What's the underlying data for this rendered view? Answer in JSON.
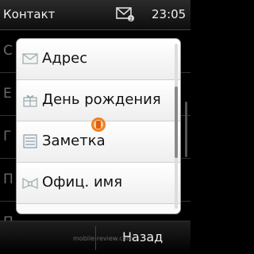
{
  "status_bar": {
    "title": "Контакт",
    "time": "23:05",
    "icon": "message-envelope-icon"
  },
  "background_list": {
    "rows": [
      "С",
      "E",
      "Г",
      "П",
      "П"
    ]
  },
  "menu": {
    "items": [
      {
        "label": "Адрес",
        "icon": "envelope-icon"
      },
      {
        "label": "День рождения",
        "icon": "gift-icon"
      },
      {
        "label": "Заметка",
        "icon": "note-icon"
      },
      {
        "label": "Офиц. имя",
        "icon": "name-tag-icon"
      }
    ],
    "badge_icon": "mobile-logo-icon"
  },
  "softkeys": {
    "right": "Назад"
  },
  "watermark": "mobile-review.com"
}
